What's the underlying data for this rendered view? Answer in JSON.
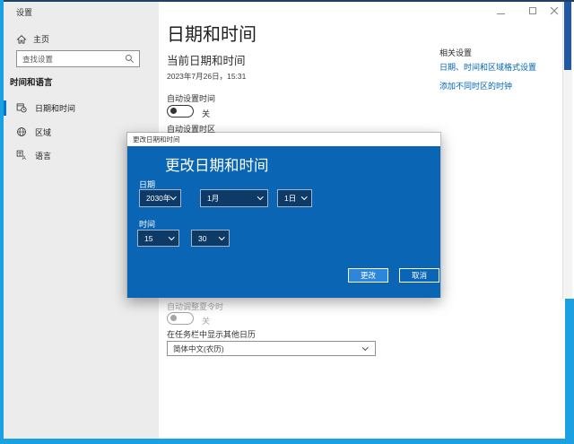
{
  "window": {
    "title": "设置"
  },
  "sidebar": {
    "home": {
      "label": "主页"
    },
    "search": {
      "placeholder": "查找设置"
    },
    "section": "时间和语言",
    "items": [
      {
        "label": "日期和时间",
        "selected": true
      },
      {
        "label": "区域",
        "selected": false
      },
      {
        "label": "语言",
        "selected": false
      }
    ]
  },
  "main": {
    "title": "日期和时间",
    "current_section": {
      "heading": "当前日期和时间",
      "datetime": "2023年7月26日，15:31"
    },
    "auto_time": {
      "label": "自动设置时间",
      "state": "关"
    },
    "auto_timezone": {
      "label": "自动设置时区"
    },
    "dst": {
      "label": "自动调整夏令时",
      "state": "关"
    },
    "calendar": {
      "label": "在任务栏中显示其他日历",
      "value": "简体中文(农历)"
    }
  },
  "related": {
    "heading": "相关设置",
    "links": [
      "日期、时间和区域格式设置",
      "添加不同时区的时钟"
    ]
  },
  "dialog": {
    "titlebar": "更改日期和时间",
    "heading": "更改日期和时间",
    "date": {
      "label": "日期",
      "year": "2030年",
      "month": "1月",
      "day": "1日"
    },
    "time": {
      "label": "时间",
      "hour": "15",
      "minute": "30"
    },
    "buttons": {
      "change": "更改",
      "cancel": "取消"
    }
  },
  "colors": {
    "dialog_blue": "#0a66b4",
    "combo_navy": "#0d3a66",
    "link_blue": "#0066b4",
    "accent": "#0078d7",
    "highlight_frame": "#1ba0e1",
    "scrollbar_thumb": "#2157a7",
    "sidebar_bg": "#ececec"
  }
}
